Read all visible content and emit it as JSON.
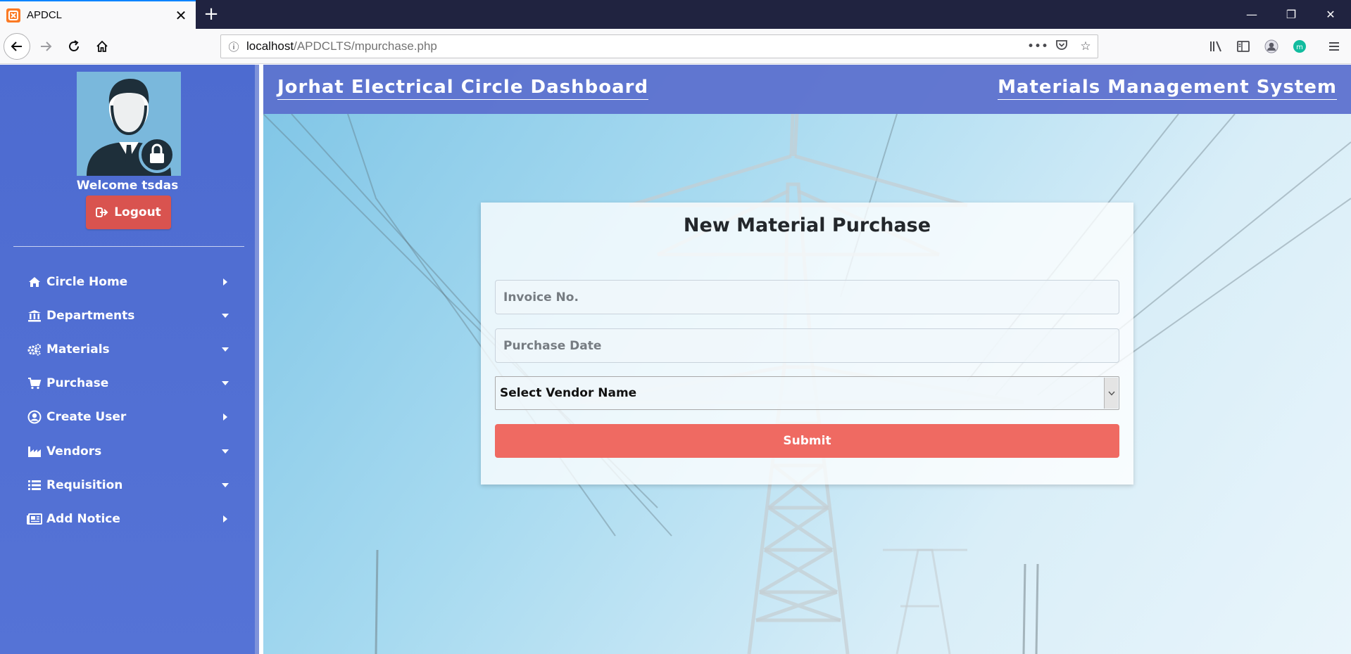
{
  "browser": {
    "tab_title": "APDCL",
    "favicon_text": "◙",
    "url_host": "localhost",
    "url_path": "/APDCLTS/mpurchase.php",
    "icons": [
      "back-icon",
      "forward-icon",
      "reload-icon",
      "home-icon",
      "site-info-icon",
      "page-actions-icon",
      "pocket-icon",
      "bookmark-star-icon",
      "library-icon",
      "sidebar-icon",
      "account-icon",
      "extension-icon",
      "hamburger-menu-icon"
    ]
  },
  "sidebar": {
    "welcome": "Welcome tsdas",
    "logout_label": "Logout",
    "items": [
      {
        "label": "Circle Home",
        "icon": "home-icon",
        "caret": "right"
      },
      {
        "label": "Departments",
        "icon": "bank-icon",
        "caret": "down"
      },
      {
        "label": "Materials",
        "icon": "cogs-icon",
        "caret": "down"
      },
      {
        "label": "Purchase",
        "icon": "cart-icon",
        "caret": "down"
      },
      {
        "label": "Create User",
        "icon": "user-circle-icon",
        "caret": "right"
      },
      {
        "label": "Vendors",
        "icon": "industry-icon",
        "caret": "down"
      },
      {
        "label": "Requisition",
        "icon": "list-icon",
        "caret": "down"
      },
      {
        "label": "Add Notice",
        "icon": "newspaper-icon",
        "caret": "right"
      }
    ]
  },
  "header": {
    "left_title": "Jorhat Electrical Circle Dashboard",
    "right_title": "Materials Management System"
  },
  "form": {
    "title": "New Material Purchase",
    "invoice_placeholder": "Invoice No.",
    "date_placeholder": "Purchase Date",
    "vendor_selected": "Select Vendor Name",
    "submit_label": "Submit"
  },
  "colors": {
    "sidebar_bg": "#4d6bd0",
    "header_bg": "#5a6ecd",
    "logout_bg": "#d9534f",
    "submit_bg": "#ef6a62"
  }
}
